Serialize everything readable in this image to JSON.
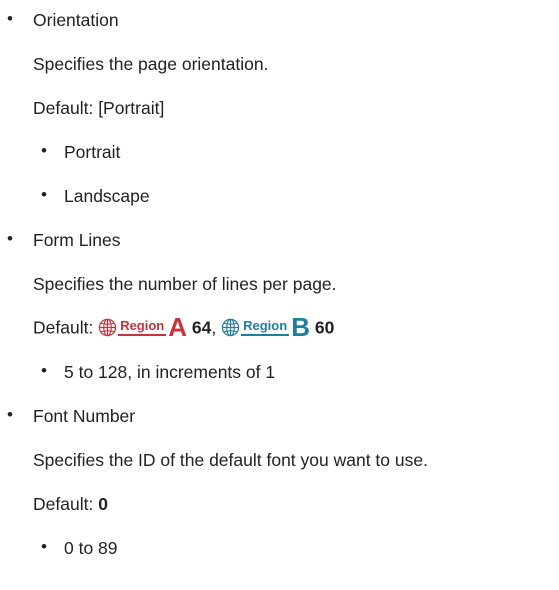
{
  "colors": {
    "regionA": "#c8333a",
    "regionB": "#1e7e9f"
  },
  "items": [
    {
      "title": "Orientation",
      "description": "Specifies the page orientation.",
      "default_label": "Default:",
      "default_value": "[Portrait]",
      "options": [
        "Portrait",
        "Landscape"
      ]
    },
    {
      "title": "Form Lines",
      "description": "Specifies the number of lines per page.",
      "default_label": "Default:",
      "region_tag": "Region",
      "region_a_letter": "A",
      "region_a_value": "64",
      "separator": ",",
      "region_b_letter": "B",
      "region_b_value": "60",
      "options": [
        "5 to 128, in increments of 1"
      ]
    },
    {
      "title": "Font Number",
      "description": "Specifies the ID of the default font you want to use.",
      "default_label": "Default:",
      "default_value": "0",
      "options": [
        "0 to 89"
      ]
    }
  ]
}
